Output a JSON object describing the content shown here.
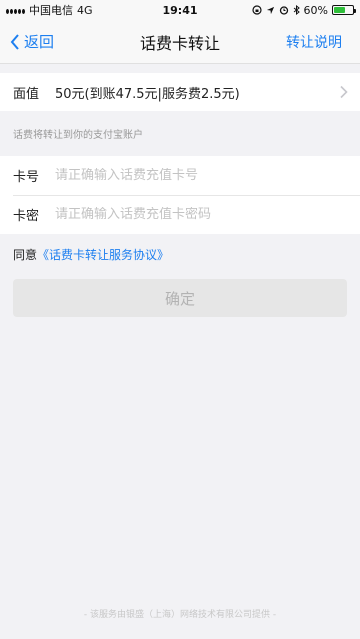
{
  "status_bar": {
    "carrier": "中国电信",
    "network": "4G",
    "time": "19:41",
    "battery": "60%",
    "battery_level": 0.6
  },
  "nav": {
    "back_label": "返回",
    "title": "话费卡转让",
    "right_label": "转让说明"
  },
  "denomination": {
    "label": "面值",
    "value": "50元(到账47.5元|服务费2.5元)"
  },
  "hint": "话费将转让到你的支付宝账户",
  "card_number": {
    "label": "卡号",
    "placeholder": "请正确输入话费充值卡号"
  },
  "card_password": {
    "label": "卡密",
    "placeholder": "请正确输入话费充值卡密码"
  },
  "agreement": {
    "prefix": "同意",
    "link": "《话费卡转让服务协议》"
  },
  "confirm_label": "确定",
  "footer": "- 该服务由银盛（上海）网络技术有限公司提供 -",
  "colors": {
    "accent": "#1d7ff0",
    "background": "#f2f2f5",
    "battery": "#2fbf3a"
  }
}
